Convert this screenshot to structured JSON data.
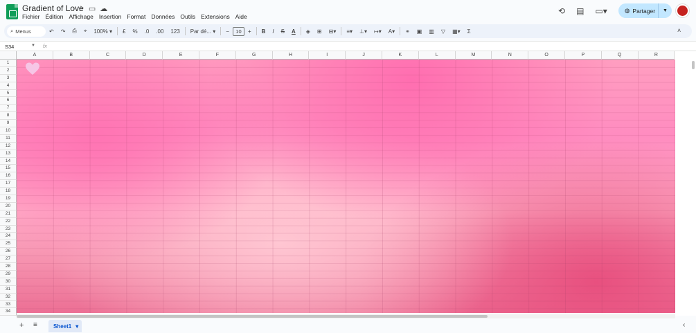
{
  "app": {
    "title": "Gradient of Love",
    "menu": [
      "Fichier",
      "Édition",
      "Affichage",
      "Insertion",
      "Format",
      "Données",
      "Outils",
      "Extensions",
      "Aide"
    ],
    "share_label": "Partager"
  },
  "toolbar": {
    "search_label": "Menus",
    "zoom": "100%",
    "currency": "£",
    "percent": "%",
    "dec_less": ".0",
    "dec_more": ".00",
    "number_format": "123",
    "font": "Par dé...",
    "font_size": "10",
    "bold": "B",
    "italic": "I",
    "strike": "S",
    "text_color": "A",
    "func": "Σ"
  },
  "formula_bar": {
    "cell_ref": "S34",
    "fx": "fx"
  },
  "grid": {
    "columns": [
      "A",
      "B",
      "C",
      "D",
      "E",
      "F",
      "G",
      "H",
      "I",
      "J",
      "K",
      "L",
      "M",
      "N",
      "O",
      "P",
      "Q",
      "R"
    ],
    "rows": [
      "1",
      "2",
      "3",
      "4",
      "5",
      "6",
      "7",
      "8",
      "9",
      "10",
      "11",
      "12",
      "13",
      "14",
      "15",
      "16",
      "17",
      "18",
      "19",
      "20",
      "21",
      "22",
      "23",
      "24",
      "25",
      "26",
      "27",
      "28",
      "29",
      "30",
      "31",
      "32",
      "33",
      "34"
    ]
  },
  "colors": {
    "heart": "#f6c6e6",
    "share_bg": "#c2e7ff",
    "accent": "#0b57d0"
  },
  "sheets": [
    {
      "name": "Sheet1",
      "active": true
    }
  ]
}
